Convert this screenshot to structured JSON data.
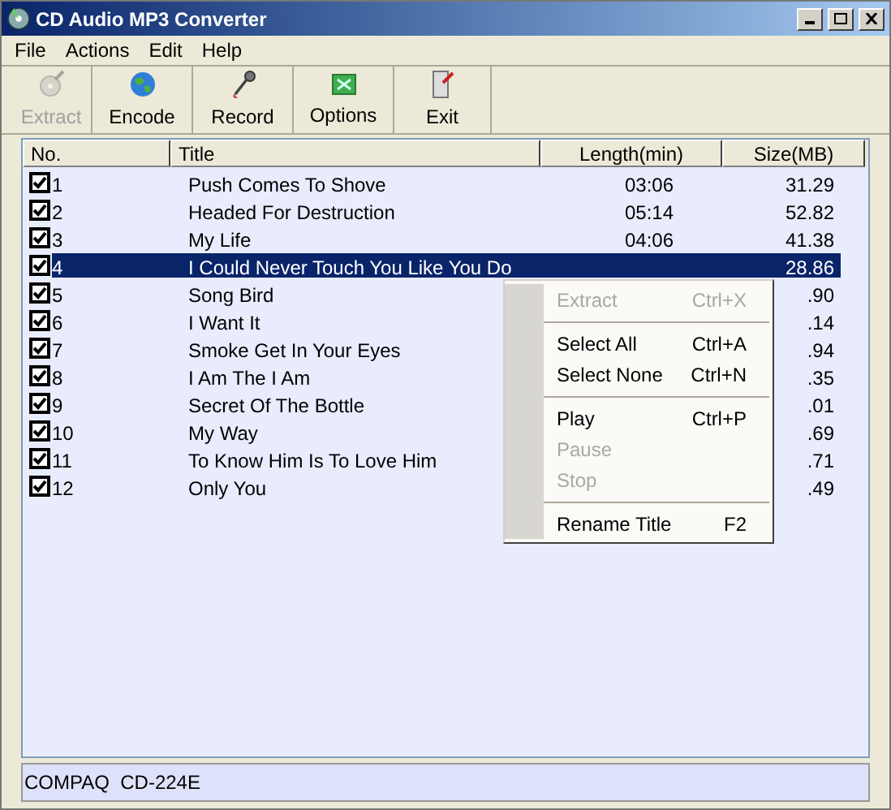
{
  "window": {
    "title": "CD Audio MP3 Converter"
  },
  "menu_bar": [
    "File",
    "Actions",
    "Edit",
    "Help"
  ],
  "toolbar": [
    {
      "label": "Extract",
      "disabled": true,
      "kind": "extract"
    },
    {
      "label": "Encode",
      "disabled": false,
      "kind": "encode"
    },
    {
      "label": "Record",
      "disabled": false,
      "kind": "record"
    },
    {
      "label": "Options",
      "disabled": false,
      "kind": "options"
    },
    {
      "label": "Exit",
      "disabled": false,
      "kind": "exit"
    }
  ],
  "table": {
    "columns": [
      "No.",
      "Title",
      "Length(min)",
      "Size(MB)"
    ],
    "rows": [
      {
        "no": "1",
        "title": "Push Comes To Shove",
        "length": "03:06",
        "size": "31.29",
        "checked": true,
        "selected": false
      },
      {
        "no": "2",
        "title": "Headed For Destruction",
        "length": "05:14",
        "size": "52.82",
        "checked": true,
        "selected": false
      },
      {
        "no": "3",
        "title": "My Life",
        "length": "04:06",
        "size": "41.38",
        "checked": true,
        "selected": false
      },
      {
        "no": "4",
        "title": "I Could Never Touch You Like You Do",
        "size": "28.86",
        "checked": true,
        "selected": true
      },
      {
        "no": "5",
        "title": "Song Bird",
        "size": ".90",
        "checked": true,
        "selected": false
      },
      {
        "no": "6",
        "title": "I Want It",
        "size": ".14",
        "checked": true,
        "selected": false
      },
      {
        "no": "7",
        "title": "Smoke Get In Your Eyes",
        "size": ".94",
        "checked": true,
        "selected": false
      },
      {
        "no": "8",
        "title": "I Am The I Am",
        "size": ".35",
        "checked": true,
        "selected": false
      },
      {
        "no": "9",
        "title": "Secret Of The Bottle",
        "size": ".01",
        "checked": true,
        "selected": false
      },
      {
        "no": "10",
        "title": "My Way",
        "size": ".69",
        "checked": true,
        "selected": false
      },
      {
        "no": "11",
        "title": "To Know Him Is To Love Him",
        "size": ".71",
        "checked": true,
        "selected": false
      },
      {
        "no": "12",
        "title": "Only You",
        "size": ".49",
        "checked": true,
        "selected": false
      }
    ]
  },
  "context_menu": [
    {
      "kind": "item",
      "label": "Extract",
      "shortcut": "Ctrl+X",
      "disabled": true
    },
    {
      "kind": "separator"
    },
    {
      "kind": "item",
      "label": "Select All",
      "shortcut": "Ctrl+A",
      "disabled": false
    },
    {
      "kind": "item",
      "label": "Select None",
      "shortcut": "Ctrl+N",
      "disabled": false
    },
    {
      "kind": "separator"
    },
    {
      "kind": "item",
      "label": "Play",
      "shortcut": "Ctrl+P",
      "disabled": false
    },
    {
      "kind": "item",
      "label": "Pause",
      "disabled": true
    },
    {
      "kind": "item",
      "label": "Stop",
      "disabled": true
    },
    {
      "kind": "separator"
    },
    {
      "kind": "item",
      "label": "Rename Title",
      "shortcut": "F2",
      "disabled": false
    }
  ],
  "status_bar": "COMPAQ  CD-224E"
}
